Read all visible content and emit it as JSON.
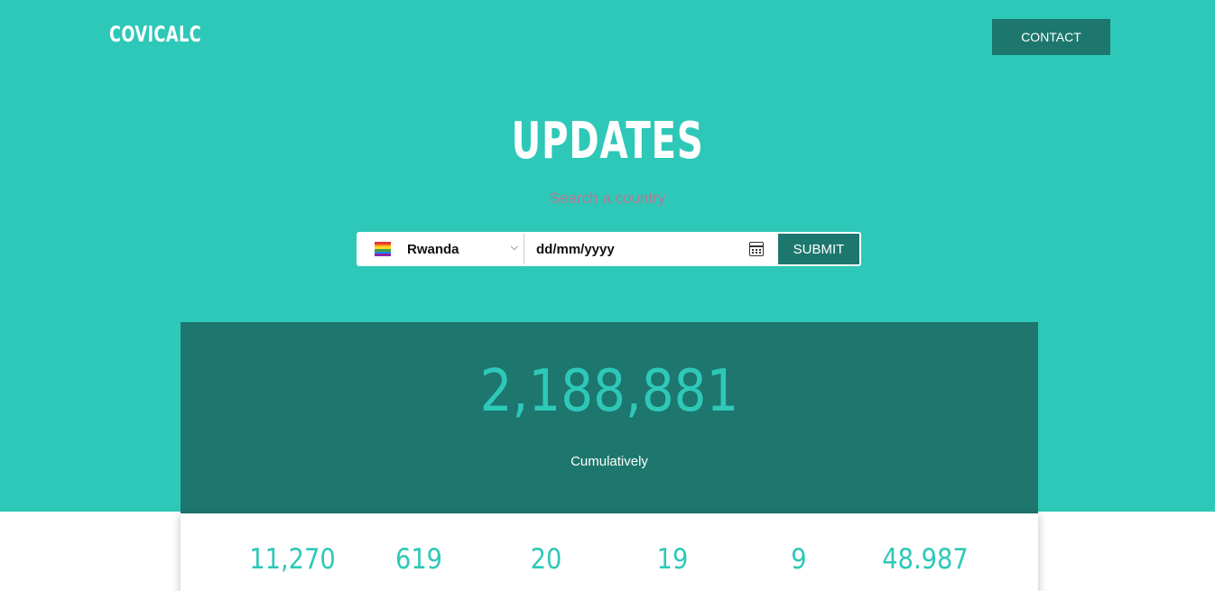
{
  "header": {
    "brand": "COVICALC",
    "contact_label": "CONTACT"
  },
  "hero": {
    "title": "UPDATES",
    "search_hint": "Search a country"
  },
  "form": {
    "country_selected": "Rwanda",
    "date_placeholder": "dd/mm/yyyy",
    "submit_label": "SUBMIT",
    "flag_colors": [
      "#e53935",
      "#ff9800",
      "#fdd835",
      "#43a047",
      "#1e88e5",
      "#8e24aa"
    ]
  },
  "summary": {
    "total": "2,188,881",
    "caption": "Cumulatively"
  },
  "metrics": [
    "11,270",
    "619",
    "20",
    "19",
    "9",
    "48.987"
  ],
  "colors": {
    "accent": "#2ec8b8",
    "dark": "#1d776e",
    "hint": "#b57a95"
  }
}
